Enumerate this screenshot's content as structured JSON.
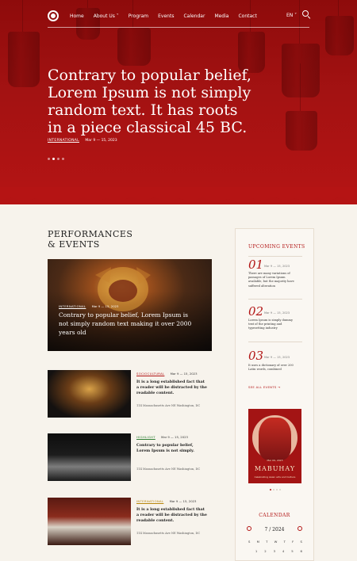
{
  "nav": {
    "items": [
      "Home",
      "About Us ˅",
      "Program",
      "Events",
      "Calendar",
      "Media",
      "Contact"
    ],
    "language": "EN ˅"
  },
  "hero": {
    "title": "Contrary to popular belief, Lorem Ipsum is not simply random text. It has roots in a piece classical 45 BC.",
    "tag": "INTERNATIONAL",
    "date": "Mar 9 — 15, 2023"
  },
  "section": {
    "title_line1": "PERFORMANCES",
    "title_line2": "& EVENTS"
  },
  "featured": {
    "tag": "INTERNATIONAL",
    "date": "Mar 9 — 15, 2023",
    "title": "Contrary to popular belief, Lorem Ipsum is not simply random text making it over 2000 years old"
  },
  "events": [
    {
      "tag": "SOCIOCULTURAL",
      "date": "Mar 9 — 15, 2023",
      "title": "It is a long established fact that a reader will be distracted by the readable content.",
      "address": "114 Massachusetts Ave NE Washington, DC",
      "tag_color": "#b21515"
    },
    {
      "tag": "HIGHLIGHT",
      "date": "Mar 9 — 15, 2023",
      "title": "Contrary to popular belief, Lorem Ipsum is not simply.",
      "address": "114 Massachusetts Ave NE Washington, DC",
      "tag_color": "#2e7d32"
    },
    {
      "tag": "INTERNATIONAL",
      "date": "Mar 9 — 15, 2023",
      "title": "It is a long established fact that a reader will be distracted by the readable content.",
      "address": "114 Massachusetts Ave NE Washington, DC",
      "tag_color": "#b8860b"
    }
  ],
  "upcoming": {
    "title": "UPCOMING EVENTS",
    "items": [
      {
        "num": "01",
        "date": "Mar 9 — 15, 2023",
        "text": "There are many variations of passages of Lorem Ipsum available, but the majority have suffered alteration"
      },
      {
        "num": "02",
        "date": "Mar 9 — 15, 2023",
        "text": "Lorem Ipsum is simply dummy text of the printing and typesetting industry"
      },
      {
        "num": "03",
        "date": "Mar 9 — 15, 2023",
        "text": "It uses a dictionary of over 200 Latin words, combined"
      }
    ],
    "see_all": "SEE ALL EVENTS →"
  },
  "poster": {
    "date_line": "Mar 09, 2023",
    "name": "MABUHAY",
    "subtitle": "Celebrating Asian arts and Culture"
  },
  "calendar": {
    "title": "CALENDAR",
    "month": "7 / 2024",
    "days": [
      "S",
      "M",
      "T",
      "W",
      "T",
      "F",
      "S"
    ],
    "first_row": [
      "",
      "1",
      "2",
      "3",
      "4",
      "5",
      "6"
    ]
  },
  "colors": {
    "brand": "#b21515",
    "hero_red": "#a31212"
  }
}
